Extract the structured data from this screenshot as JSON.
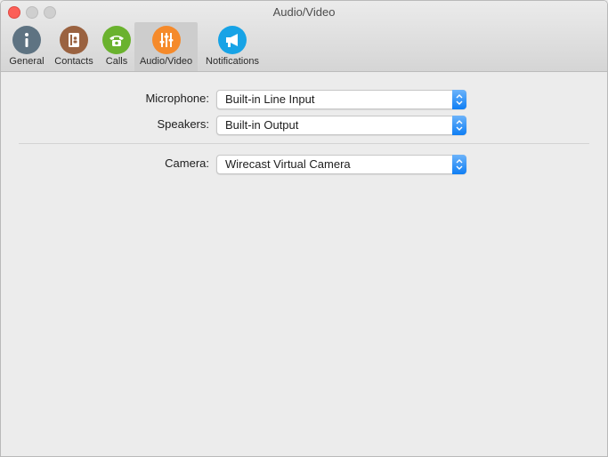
{
  "window": {
    "title": "Audio/Video"
  },
  "toolbar": {
    "tabs": [
      {
        "label": "General",
        "icon": "info-icon",
        "color": "#5e7382"
      },
      {
        "label": "Contacts",
        "icon": "address-book-icon",
        "color": "#9a6240"
      },
      {
        "label": "Calls",
        "icon": "phone-icon",
        "color": "#6ab22e"
      },
      {
        "label": "Audio/Video",
        "icon": "sliders-icon",
        "color": "#f58a2b",
        "selected": true
      },
      {
        "label": "Notifications",
        "icon": "megaphone-icon",
        "color": "#17a3e6"
      }
    ]
  },
  "settings": {
    "microphone": {
      "label": "Microphone:",
      "value": "Built-in Line Input"
    },
    "speakers": {
      "label": "Speakers:",
      "value": "Built-in Output"
    },
    "camera": {
      "label": "Camera:",
      "value": "Wirecast Virtual Camera"
    }
  },
  "colors": {
    "accent": "#1a84f6"
  }
}
